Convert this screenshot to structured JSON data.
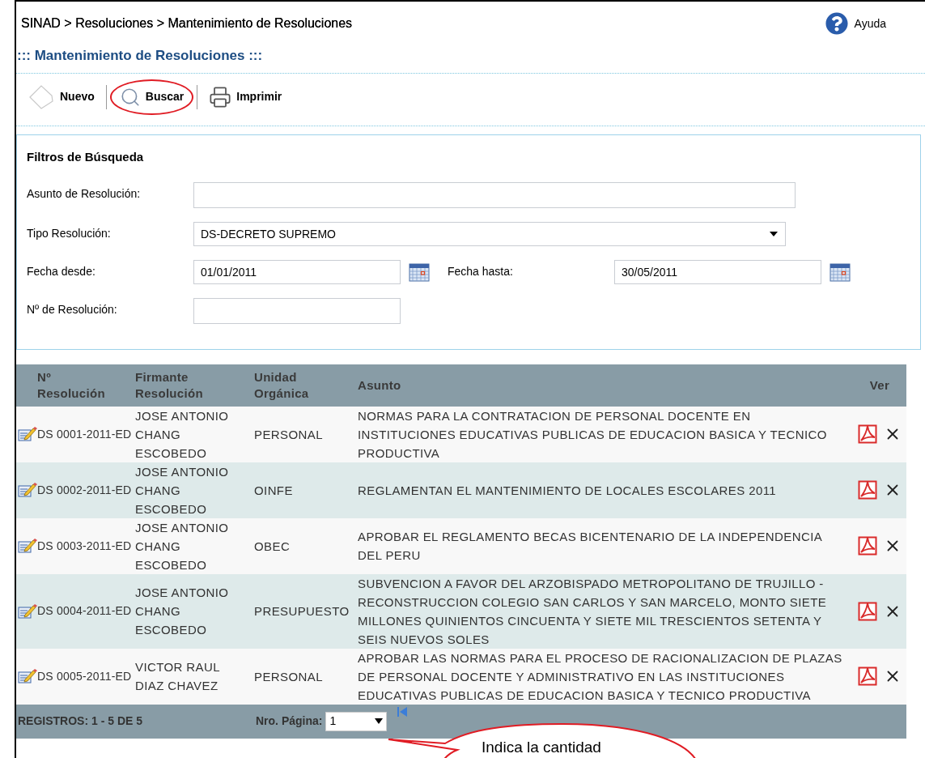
{
  "breadcrumb": "SINAD > Resoluciones > Mantenimiento de Resoluciones",
  "help": {
    "label": "Ayuda"
  },
  "page_title": "::: Mantenimiento de Resoluciones :::",
  "toolbar": [
    {
      "kind": "new",
      "label": "Nuevo",
      "highlighted": false
    },
    {
      "kind": "search",
      "label": "Buscar",
      "highlighted": true
    },
    {
      "kind": "print",
      "label": "Imprimir",
      "highlighted": false
    }
  ],
  "filters": {
    "title": "Filtros de Búsqueda",
    "rows": [
      [
        {
          "kind": "text",
          "label": "Asunto de Resolución:"
        }
      ],
      [
        {
          "kind": "select",
          "label": "Tipo Resolución:",
          "value": "DS-DECRETO SUPREMO"
        }
      ],
      [
        {
          "kind": "date",
          "label": "Fecha desde:",
          "value": "01/01/2011"
        },
        {
          "kind": "date",
          "label": "Fecha hasta:",
          "value": "30/05/2011"
        }
      ],
      [
        {
          "kind": "short",
          "label": "Nº de Resolución:"
        }
      ]
    ]
  },
  "table": {
    "columns": [
      "Nº Resolución",
      "Firmante Resolución",
      "Unidad Orgánica",
      "Asunto",
      "Ver"
    ],
    "rows": [
      {
        "numero": "DS 0001-2011-ED",
        "firmante": "JOSE ANTONIO CHANG ESCOBEDO",
        "unidad": "PERSONAL",
        "asunto": "NORMAS PARA LA CONTRATACION DE PERSONAL DOCENTE EN INSTITUCIONES EDUCATIVAS PUBLICAS DE EDUCACION BASICA Y TECNICO PRODUCTIVA"
      },
      {
        "numero": "DS 0002-2011-ED",
        "firmante": "JOSE ANTONIO CHANG ESCOBEDO",
        "unidad": "OINFE",
        "asunto": "REGLAMENTAN EL MANTENIMIENTO DE LOCALES ESCOLARES 2011"
      },
      {
        "numero": "DS 0003-2011-ED",
        "firmante": "JOSE ANTONIO CHANG ESCOBEDO",
        "unidad": "OBEC",
        "asunto": "APROBAR EL REGLAMENTO BECAS BICENTENARIO DE LA INDEPENDENCIA DEL PERU"
      },
      {
        "numero": "DS 0004-2011-ED",
        "firmante": "JOSE ANTONIO CHANG ESCOBEDO",
        "unidad": "PRESUPUESTO",
        "asunto": "SUBVENCION A FAVOR DEL ARZOBISPADO METROPOLITANO DE TRUJILLO - RECONSTRUCCION COLEGIO SAN CARLOS Y SAN MARCELO, MONTO SIETE MILLONES QUINIENTOS CINCUENTA Y SIETE MIL TRESCIENTOS SETENTA Y SEIS NUEVOS SOLES"
      },
      {
        "numero": "DS 0005-2011-ED",
        "firmante": "VICTOR RAUL DIAZ CHAVEZ",
        "unidad": "PERSONAL",
        "asunto": "APROBAR LAS NORMAS PARA EL PROCESO DE RACIONALIZACION DE PLAZAS DE PERSONAL DOCENTE Y ADMINISTRATIVO EN LAS INSTITUCIONES EDUCATIVAS PUBLICAS DE EDUCACION BASICA Y TECNICO PRODUCTIVA"
      }
    ]
  },
  "footer": {
    "records": "REGISTROS: 1 - 5 DE 5",
    "page_label": "Nro. Página:",
    "page_value": "1"
  },
  "callout": {
    "text": "Indica la cantidad"
  }
}
